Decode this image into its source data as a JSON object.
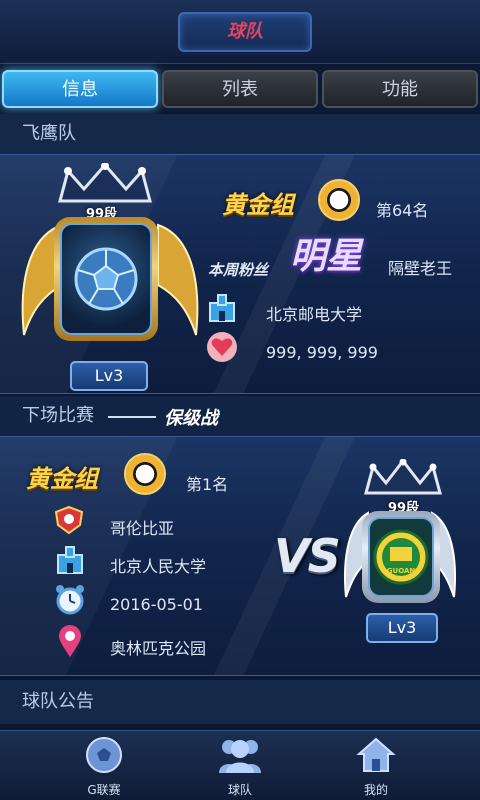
{
  "header": {
    "title": "球队"
  },
  "tabs": [
    {
      "label": "信息",
      "active": true
    },
    {
      "label": "列表",
      "active": false
    },
    {
      "label": "功能",
      "active": false
    }
  ],
  "team": {
    "name": "飞鹰队",
    "rank_label": "99段",
    "level": "Lv3",
    "group": "黄金组",
    "position": "第64名",
    "fan_label": "本周粉丝",
    "fan_badge": "明星",
    "fan_name": "隔壁老王",
    "school": "北京邮电大学",
    "fans_count": "999, 999, 999"
  },
  "next_match": {
    "heading": "下场比赛",
    "match_type": "保级战",
    "group": "黄金组",
    "position": "第1名",
    "opponent": "哥伦比亚",
    "school": "北京人民大学",
    "date": "2016-05-01",
    "venue": "奥林匹克公园",
    "vs_text": "VS",
    "opponent_rank_label": "99段",
    "opponent_level": "Lv3",
    "opponent_logo_text": "GUOAN"
  },
  "announcement": {
    "heading": "球队公告"
  },
  "bottom_nav": [
    {
      "label": "G联赛",
      "icon": "soccer-ball-icon"
    },
    {
      "label": "球队",
      "icon": "team-icon"
    },
    {
      "label": "我的",
      "icon": "home-icon"
    }
  ],
  "colors": {
    "accent_blue": "#1478c9",
    "gold": "#ffd34a",
    "title_red": "#e5445b",
    "fans_heart": "#e23c57"
  }
}
